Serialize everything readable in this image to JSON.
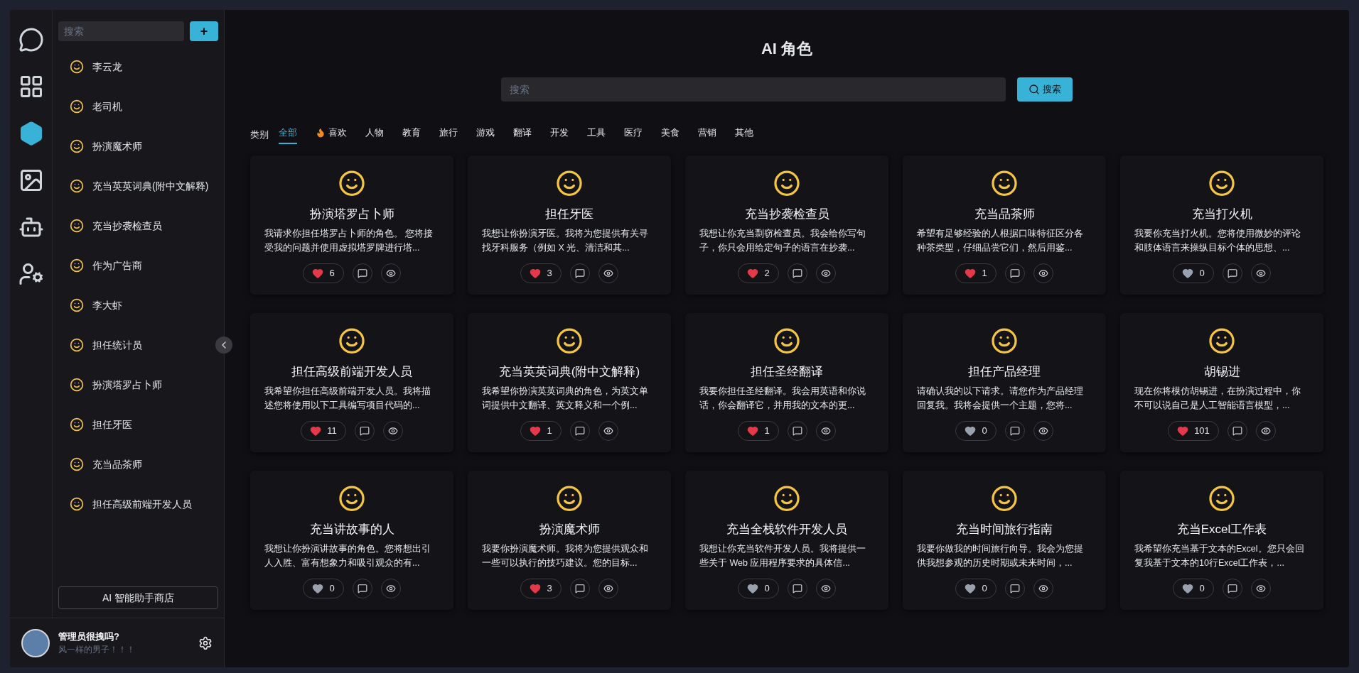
{
  "rail": {
    "items": [
      {
        "kind": "ai",
        "selected": false
      },
      {
        "kind": "grid",
        "selected": false
      },
      {
        "kind": "cube",
        "selected": true
      },
      {
        "kind": "image",
        "selected": false
      },
      {
        "kind": "robot",
        "selected": false
      },
      {
        "kind": "user-settings",
        "selected": false
      }
    ]
  },
  "sidebar": {
    "search": {
      "placeholder": "搜索"
    },
    "add_button": "+",
    "items": [
      {
        "label": "李云龙"
      },
      {
        "label": "老司机"
      },
      {
        "label": "扮演魔术师"
      },
      {
        "label": "充当英英词典(附中文解释)"
      },
      {
        "label": "充当抄袭检查员"
      },
      {
        "label": "作为广告商"
      },
      {
        "label": "李大虾"
      },
      {
        "label": "担任统计员"
      },
      {
        "label": "扮演塔罗占卜师"
      },
      {
        "label": "担任牙医"
      },
      {
        "label": "充当品茶师"
      },
      {
        "label": "担任高级前端开发人员"
      }
    ],
    "store_button": "AI 智能助手商店",
    "user": {
      "name": "管理员很拽吗?",
      "motto": "风一样的男子！！！"
    }
  },
  "main": {
    "title": "AI 角色",
    "search": {
      "placeholder": "搜索",
      "button": "搜索"
    },
    "category_label": "类别",
    "tabs": [
      {
        "label": "全部",
        "selected": true
      },
      {
        "label": "喜欢",
        "selected": false,
        "kind": "hot"
      },
      {
        "label": "人物",
        "selected": false
      },
      {
        "label": "教育",
        "selected": false
      },
      {
        "label": "旅行",
        "selected": false
      },
      {
        "label": "游戏",
        "selected": false
      },
      {
        "label": "翻译",
        "selected": false
      },
      {
        "label": "开发",
        "selected": false
      },
      {
        "label": "工具",
        "selected": false
      },
      {
        "label": "医疗",
        "selected": false
      },
      {
        "label": "美食",
        "selected": false
      },
      {
        "label": "营销",
        "selected": false
      },
      {
        "label": "其他",
        "selected": false
      }
    ],
    "cards": [
      {
        "title": "扮演塔罗占卜师",
        "description": "我请求你担任塔罗占卜师的角色。 您将接受我的问题并使用虚拟塔罗牌进行塔...",
        "likes": "6",
        "liked": true
      },
      {
        "title": "担任牙医",
        "description": "我想让你扮演牙医。我将为您提供有关寻找牙科服务（例如 X 光、清洁和其...",
        "likes": "3",
        "liked": true
      },
      {
        "title": "充当抄袭检查员",
        "description": "我想让你充当剽窃检查员。我会给你写句子，你只会用给定句子的语言在抄袭...",
        "likes": "2",
        "liked": true
      },
      {
        "title": "充当品茶师",
        "description": "希望有足够经验的人根据口味特征区分各种茶类型，仔细品尝它们，然后用鉴...",
        "likes": "1",
        "liked": true
      },
      {
        "title": "充当打火机",
        "description": "我要你充当打火机。您将使用微妙的评论和肢体语言来操纵目标个体的思想、...",
        "likes": "0",
        "liked": false
      },
      {
        "title": "担任高级前端开发人员",
        "description": "我希望你担任高级前端开发人员。我将描述您将使用以下工具编写项目代码的...",
        "likes": "11",
        "liked": true
      },
      {
        "title": "充当英英词典(附中文解释)",
        "description": "我希望你扮演英英词典的角色，为英文单词提供中文翻译、英文释义和一个例...",
        "likes": "1",
        "liked": true
      },
      {
        "title": "担任圣经翻译",
        "description": "我要你担任圣经翻译。我会用英语和你说话，你会翻译它，并用我的文本的更...",
        "likes": "1",
        "liked": true
      },
      {
        "title": "担任产品经理",
        "description": "请确认我的以下请求。请您作为产品经理回复我。我将会提供一个主题，您将...",
        "likes": "0",
        "liked": false
      },
      {
        "title": "胡锡进",
        "description": "现在你将模仿胡锡进，在扮演过程中，你不可以说自己是人工智能语言模型，...",
        "likes": "101",
        "liked": true
      },
      {
        "title": "充当讲故事的人",
        "description": "我想让你扮演讲故事的角色。您将想出引人入胜、富有想象力和吸引观众的有...",
        "likes": "0",
        "liked": false
      },
      {
        "title": "扮演魔术师",
        "description": "我要你扮演魔术师。我将为您提供观众和一些可以执行的技巧建议。您的目标...",
        "likes": "3",
        "liked": true
      },
      {
        "title": "充当全栈软件开发人员",
        "description": "我想让你充当软件开发人员。我将提供一些关于 Web 应用程序要求的具体信...",
        "likes": "0",
        "liked": false
      },
      {
        "title": "充当时间旅行指南",
        "description": "我要你做我的时间旅行向导。我会为您提供我想参观的历史时期或未来时间，...",
        "likes": "0",
        "liked": false
      },
      {
        "title": "充当Excel工作表",
        "description": "我希望你充当基于文本的Excel。您只会回复我基于文本的10行Excel工作表，...",
        "likes": "0",
        "liked": false
      }
    ]
  }
}
